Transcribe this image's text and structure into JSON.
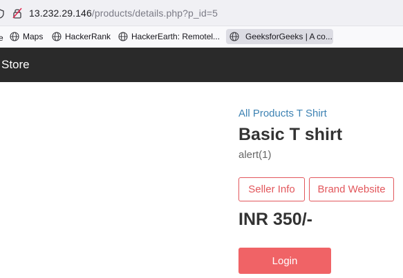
{
  "browser": {
    "url_host": "13.232.29.146",
    "url_path": "/products/details.php?p_id=5",
    "bookmarks": [
      {
        "label": "Maps",
        "icon": "globe-icon"
      },
      {
        "label": "HackerRank",
        "icon": "globe-icon"
      },
      {
        "label": "HackerEarth: Remotel...",
        "icon": "globe-icon"
      },
      {
        "label": "GeeksforGeeks | A co...",
        "icon": "globe-icon"
      }
    ],
    "bookmark_edge_label": "e"
  },
  "navbar": {
    "brand": "Store"
  },
  "product": {
    "breadcrumb": "All Products T Shirt",
    "name": "Basic T shirt",
    "description": "alert(1)",
    "seller_info_label": "Seller Info",
    "brand_website_label": "Brand Website",
    "price": "INR 350/-",
    "login_label": "Login"
  },
  "colors": {
    "navbar_bg": "#2a2a2a",
    "link": "#3d82b3",
    "accent": "#e2565b",
    "login_bg": "#f06366"
  }
}
